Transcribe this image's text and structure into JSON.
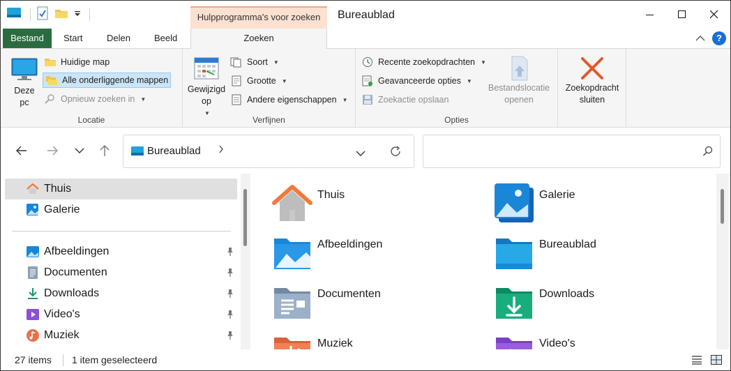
{
  "window": {
    "title": "Bureaublad",
    "tool_tab": "Hulpprogramma's voor zoeken"
  },
  "tabs": {
    "file": "Bestand",
    "start": "Start",
    "share": "Delen",
    "view": "Beeld",
    "search": "Zoeken"
  },
  "ribbon": {
    "location": {
      "label": "Locatie",
      "this_pc": "Deze pc",
      "current_folder": "Huidige map",
      "all_subfolders": "Alle onderliggende mappen",
      "search_again_in": "Opnieuw zoeken in"
    },
    "refine": {
      "label": "Verfijnen",
      "date_modified": "Gewijzigd op",
      "kind": "Soort",
      "size": "Grootte",
      "other_properties": "Andere eigenschappen"
    },
    "options": {
      "label": "Opties",
      "recent_searches": "Recente zoekopdrachten",
      "advanced_options": "Geavanceerde opties",
      "save_search": "Zoekactie opslaan",
      "open_file_location": "Bestandslocatie openen"
    },
    "close": {
      "close_search": "Zoekopdracht sluiten"
    }
  },
  "address": {
    "path": "Bureaublad",
    "search_placeholder": ""
  },
  "nav_pane": {
    "items": [
      {
        "label": "Thuis"
      },
      {
        "label": "Galerie"
      },
      {
        "label": "Afbeeldingen"
      },
      {
        "label": "Documenten"
      },
      {
        "label": "Downloads"
      },
      {
        "label": "Video's"
      },
      {
        "label": "Muziek"
      }
    ]
  },
  "main": {
    "tiles": [
      {
        "label": "Thuis"
      },
      {
        "label": "Galerie"
      },
      {
        "label": "Afbeeldingen"
      },
      {
        "label": "Bureaublad"
      },
      {
        "label": "Documenten"
      },
      {
        "label": "Downloads"
      },
      {
        "label": "Muziek"
      },
      {
        "label": "Video's"
      }
    ]
  },
  "status": {
    "item_count": "27 items",
    "selection": "1 item geselecteerd"
  },
  "colors": {
    "file_tab": "#2a6c3f",
    "tool_tab": "#fde0cf",
    "accent": "#1a6fd6",
    "close_x": "#e2572b"
  }
}
